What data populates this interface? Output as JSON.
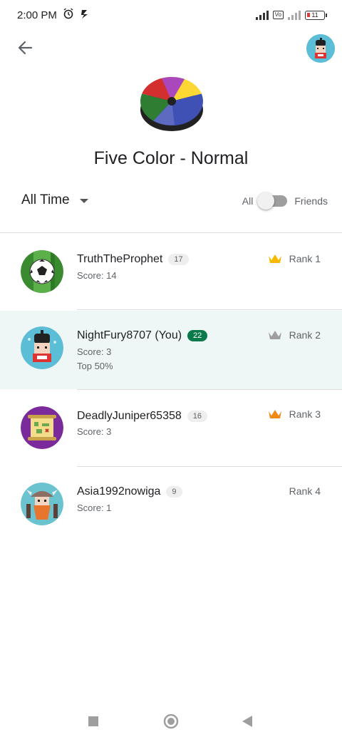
{
  "status_bar": {
    "time": "2:00 PM",
    "battery": "11"
  },
  "game": {
    "title": "Five Color - Normal"
  },
  "filters": {
    "time_range": "All Time",
    "toggle_left": "All",
    "toggle_right": "Friends"
  },
  "leaderboard": [
    {
      "name": "TruthTheProphet",
      "level": "17",
      "score": "Score: 14",
      "extra": "",
      "rank": "Rank 1",
      "crown": "gold-crown-icon"
    },
    {
      "name": "NightFury8707 (You)",
      "level": "22",
      "score": "Score: 3",
      "extra": "Top 50%",
      "rank": "Rank 2",
      "crown": "silver-crown-icon"
    },
    {
      "name": "DeadlyJuniper65358",
      "level": "16",
      "score": "Score: 3",
      "extra": "",
      "rank": "Rank 3",
      "crown": "bronze-crown-icon"
    },
    {
      "name": "Asia1992nowiga",
      "level": "9",
      "score": "Score: 1",
      "extra": "",
      "rank": "Rank 4",
      "crown": ""
    }
  ],
  "colors": {
    "accent_green": "#0b7a4b",
    "highlight_row": "#eef7f5",
    "gold": "#f9b800",
    "silver": "#9e9e9e",
    "bronze": "#ef8a17"
  }
}
